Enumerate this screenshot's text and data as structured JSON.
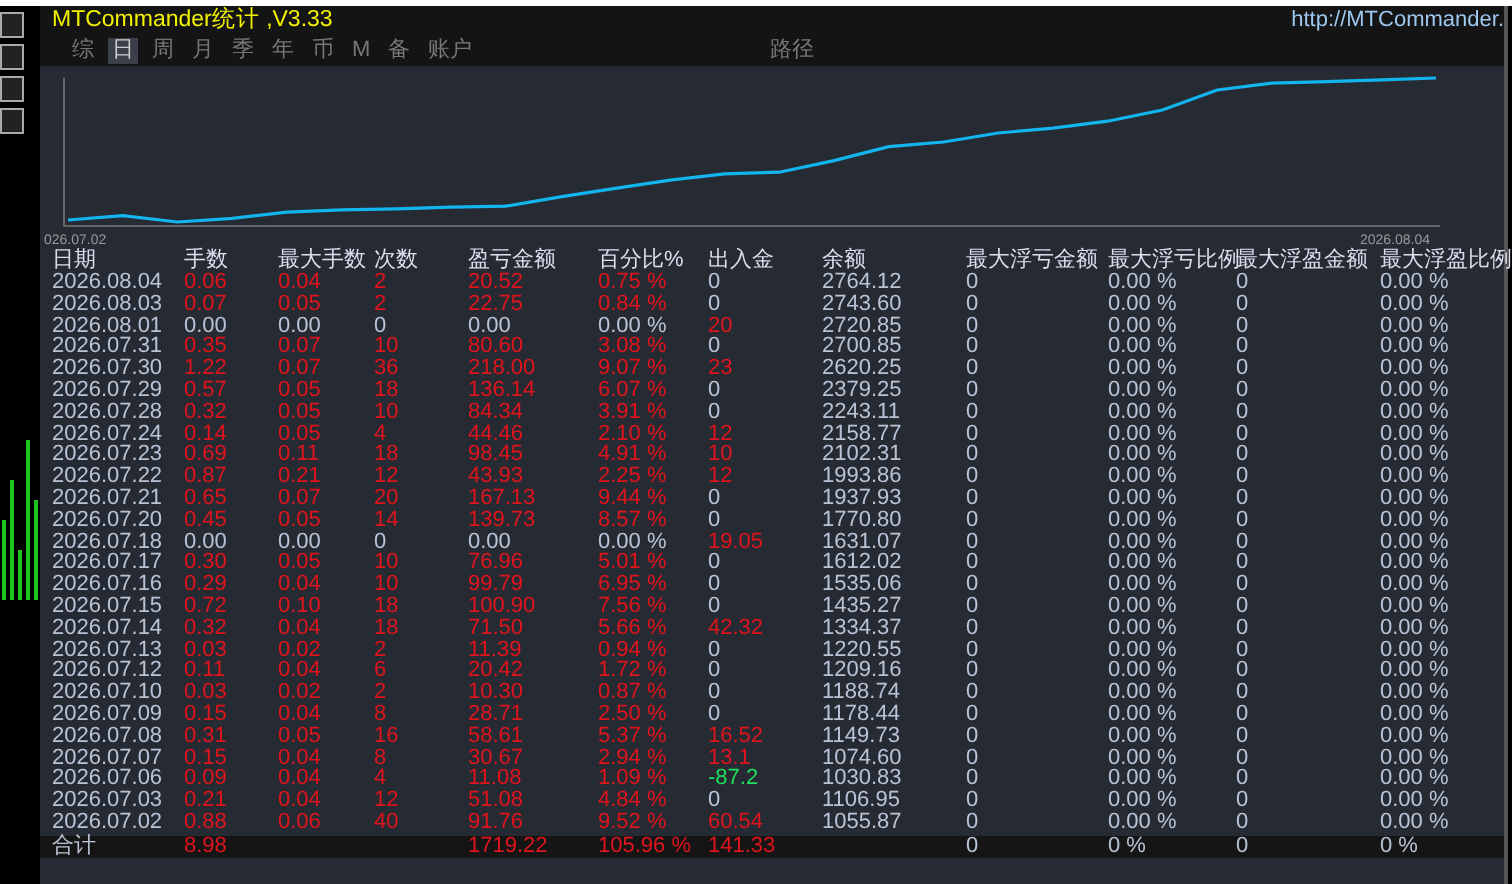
{
  "window": {
    "title": "MTCommander统计 ,V3.33",
    "link": "http://MTCommander."
  },
  "tabs": [
    {
      "label": "综",
      "selected": false
    },
    {
      "label": "日",
      "selected": true
    },
    {
      "label": "周",
      "selected": false
    },
    {
      "label": "月",
      "selected": false
    },
    {
      "label": "季",
      "selected": false
    },
    {
      "label": "年",
      "selected": false
    },
    {
      "label": "币",
      "selected": false
    },
    {
      "label": "M",
      "selected": false
    },
    {
      "label": "备",
      "selected": false
    },
    {
      "label": "账户",
      "selected": false
    },
    {
      "label": "路径",
      "selected": false
    }
  ],
  "chart": {
    "start_label": "026.07.02",
    "end_label": "2026.08.04"
  },
  "table": {
    "columns": [
      "日期",
      "手数",
      "最大手数",
      "次数",
      "盈亏金额",
      "百分比%",
      "出入金",
      "余额",
      "最大浮亏金额",
      "最大浮亏比例",
      "最大浮盈金额",
      "最大浮盈比例"
    ],
    "rows": [
      {
        "cells": [
          "2026.08.04",
          "0.06",
          "0.04",
          "2",
          "20.52",
          "0.75 %",
          "0",
          "2764.12",
          "0",
          "0.00 %",
          "0",
          "0.00 %"
        ],
        "trading": true,
        "flow_highlighted": false,
        "flow_out": false
      },
      {
        "cells": [
          "2026.08.03",
          "0.07",
          "0.05",
          "2",
          "22.75",
          "0.84 %",
          "0",
          "2743.60",
          "0",
          "0.00 %",
          "0",
          "0.00 %"
        ],
        "trading": true,
        "flow_highlighted": false,
        "flow_out": false
      },
      {
        "cells": [
          "2026.08.01",
          "0.00",
          "0.00",
          "0",
          "0.00",
          "0.00 %",
          "20",
          "2720.85",
          "0",
          "0.00 %",
          "0",
          "0.00 %"
        ],
        "trading": false,
        "flow_highlighted": true,
        "flow_out": false
      },
      {
        "cells": [
          "2026.07.31",
          "0.35",
          "0.07",
          "10",
          "80.60",
          "3.08 %",
          "0",
          "2700.85",
          "0",
          "0.00 %",
          "0",
          "0.00 %"
        ],
        "trading": true,
        "flow_highlighted": false,
        "flow_out": false
      },
      {
        "cells": [
          "2026.07.30",
          "1.22",
          "0.07",
          "36",
          "218.00",
          "9.07 %",
          "23",
          "2620.25",
          "0",
          "0.00 %",
          "0",
          "0.00 %"
        ],
        "trading": true,
        "flow_highlighted": true,
        "flow_out": false
      },
      {
        "cells": [
          "2026.07.29",
          "0.57",
          "0.05",
          "18",
          "136.14",
          "6.07 %",
          "0",
          "2379.25",
          "0",
          "0.00 %",
          "0",
          "0.00 %"
        ],
        "trading": true,
        "flow_highlighted": false,
        "flow_out": false
      },
      {
        "cells": [
          "2026.07.28",
          "0.32",
          "0.05",
          "10",
          "84.34",
          "3.91 %",
          "0",
          "2243.11",
          "0",
          "0.00 %",
          "0",
          "0.00 %"
        ],
        "trading": true,
        "flow_highlighted": false,
        "flow_out": false
      },
      {
        "cells": [
          "2026.07.24",
          "0.14",
          "0.05",
          "4",
          "44.46",
          "2.10 %",
          "12",
          "2158.77",
          "0",
          "0.00 %",
          "0",
          "0.00 %"
        ],
        "trading": true,
        "flow_highlighted": true,
        "flow_out": false
      },
      {
        "cells": [
          "2026.07.23",
          "0.69",
          "0.11",
          "18",
          "98.45",
          "4.91 %",
          "10",
          "2102.31",
          "0",
          "0.00 %",
          "0",
          "0.00 %"
        ],
        "trading": true,
        "flow_highlighted": true,
        "flow_out": false
      },
      {
        "cells": [
          "2026.07.22",
          "0.87",
          "0.21",
          "12",
          "43.93",
          "2.25 %",
          "12",
          "1993.86",
          "0",
          "0.00 %",
          "0",
          "0.00 %"
        ],
        "trading": true,
        "flow_highlighted": true,
        "flow_out": false
      },
      {
        "cells": [
          "2026.07.21",
          "0.65",
          "0.07",
          "20",
          "167.13",
          "9.44 %",
          "0",
          "1937.93",
          "0",
          "0.00 %",
          "0",
          "0.00 %"
        ],
        "trading": true,
        "flow_highlighted": false,
        "flow_out": false
      },
      {
        "cells": [
          "2026.07.20",
          "0.45",
          "0.05",
          "14",
          "139.73",
          "8.57 %",
          "0",
          "1770.80",
          "0",
          "0.00 %",
          "0",
          "0.00 %"
        ],
        "trading": true,
        "flow_highlighted": false,
        "flow_out": false
      },
      {
        "cells": [
          "2026.07.18",
          "0.00",
          "0.00",
          "0",
          "0.00",
          "0.00 %",
          "19.05",
          "1631.07",
          "0",
          "0.00 %",
          "0",
          "0.00 %"
        ],
        "trading": false,
        "flow_highlighted": true,
        "flow_out": false
      },
      {
        "cells": [
          "2026.07.17",
          "0.30",
          "0.05",
          "10",
          "76.96",
          "5.01 %",
          "0",
          "1612.02",
          "0",
          "0.00 %",
          "0",
          "0.00 %"
        ],
        "trading": true,
        "flow_highlighted": false,
        "flow_out": false
      },
      {
        "cells": [
          "2026.07.16",
          "0.29",
          "0.04",
          "10",
          "99.79",
          "6.95 %",
          "0",
          "1535.06",
          "0",
          "0.00 %",
          "0",
          "0.00 %"
        ],
        "trading": true,
        "flow_highlighted": false,
        "flow_out": false
      },
      {
        "cells": [
          "2026.07.15",
          "0.72",
          "0.10",
          "18",
          "100.90",
          "7.56 %",
          "0",
          "1435.27",
          "0",
          "0.00 %",
          "0",
          "0.00 %"
        ],
        "trading": true,
        "flow_highlighted": false,
        "flow_out": false
      },
      {
        "cells": [
          "2026.07.14",
          "0.32",
          "0.04",
          "18",
          "71.50",
          "5.66 %",
          "42.32",
          "1334.37",
          "0",
          "0.00 %",
          "0",
          "0.00 %"
        ],
        "trading": true,
        "flow_highlighted": true,
        "flow_out": false
      },
      {
        "cells": [
          "2026.07.13",
          "0.03",
          "0.02",
          "2",
          "11.39",
          "0.94 %",
          "0",
          "1220.55",
          "0",
          "0.00 %",
          "0",
          "0.00 %"
        ],
        "trading": true,
        "flow_highlighted": false,
        "flow_out": false
      },
      {
        "cells": [
          "2026.07.12",
          "0.11",
          "0.04",
          "6",
          "20.42",
          "1.72 %",
          "0",
          "1209.16",
          "0",
          "0.00 %",
          "0",
          "0.00 %"
        ],
        "trading": true,
        "flow_highlighted": false,
        "flow_out": false
      },
      {
        "cells": [
          "2026.07.10",
          "0.03",
          "0.02",
          "2",
          "10.30",
          "0.87 %",
          "0",
          "1188.74",
          "0",
          "0.00 %",
          "0",
          "0.00 %"
        ],
        "trading": true,
        "flow_highlighted": false,
        "flow_out": false
      },
      {
        "cells": [
          "2026.07.09",
          "0.15",
          "0.04",
          "8",
          "28.71",
          "2.50 %",
          "0",
          "1178.44",
          "0",
          "0.00 %",
          "0",
          "0.00 %"
        ],
        "trading": true,
        "flow_highlighted": false,
        "flow_out": false
      },
      {
        "cells": [
          "2026.07.08",
          "0.31",
          "0.05",
          "16",
          "58.61",
          "5.37 %",
          "16.52",
          "1149.73",
          "0",
          "0.00 %",
          "0",
          "0.00 %"
        ],
        "trading": true,
        "flow_highlighted": true,
        "flow_out": false
      },
      {
        "cells": [
          "2026.07.07",
          "0.15",
          "0.04",
          "8",
          "30.67",
          "2.94 %",
          "13.1",
          "1074.60",
          "0",
          "0.00 %",
          "0",
          "0.00 %"
        ],
        "trading": true,
        "flow_highlighted": true,
        "flow_out": false
      },
      {
        "cells": [
          "2026.07.06",
          "0.09",
          "0.04",
          "4",
          "11.08",
          "1.09 %",
          "-87.2",
          "1030.83",
          "0",
          "0.00 %",
          "0",
          "0.00 %"
        ],
        "trading": true,
        "flow_highlighted": true,
        "flow_out": true
      },
      {
        "cells": [
          "2026.07.03",
          "0.21",
          "0.04",
          "12",
          "51.08",
          "4.84 %",
          "0",
          "1106.95",
          "0",
          "0.00 %",
          "0",
          "0.00 %"
        ],
        "trading": true,
        "flow_highlighted": false,
        "flow_out": false
      },
      {
        "cells": [
          "2026.07.02",
          "0.88",
          "0.06",
          "40",
          "91.76",
          "9.52 %",
          "60.54",
          "1055.87",
          "0",
          "0.00 %",
          "0",
          "0.00 %"
        ],
        "trading": true,
        "flow_highlighted": true,
        "flow_out": false
      }
    ],
    "total": {
      "label": "合计",
      "lots": "8.98",
      "pnl": "1719.22",
      "pct": "105.96 %",
      "flow": "141.33",
      "float_loss": "0",
      "float_loss_pct": "0 %",
      "float_profit": "0",
      "float_profit_pct": "0 %"
    }
  }
}
